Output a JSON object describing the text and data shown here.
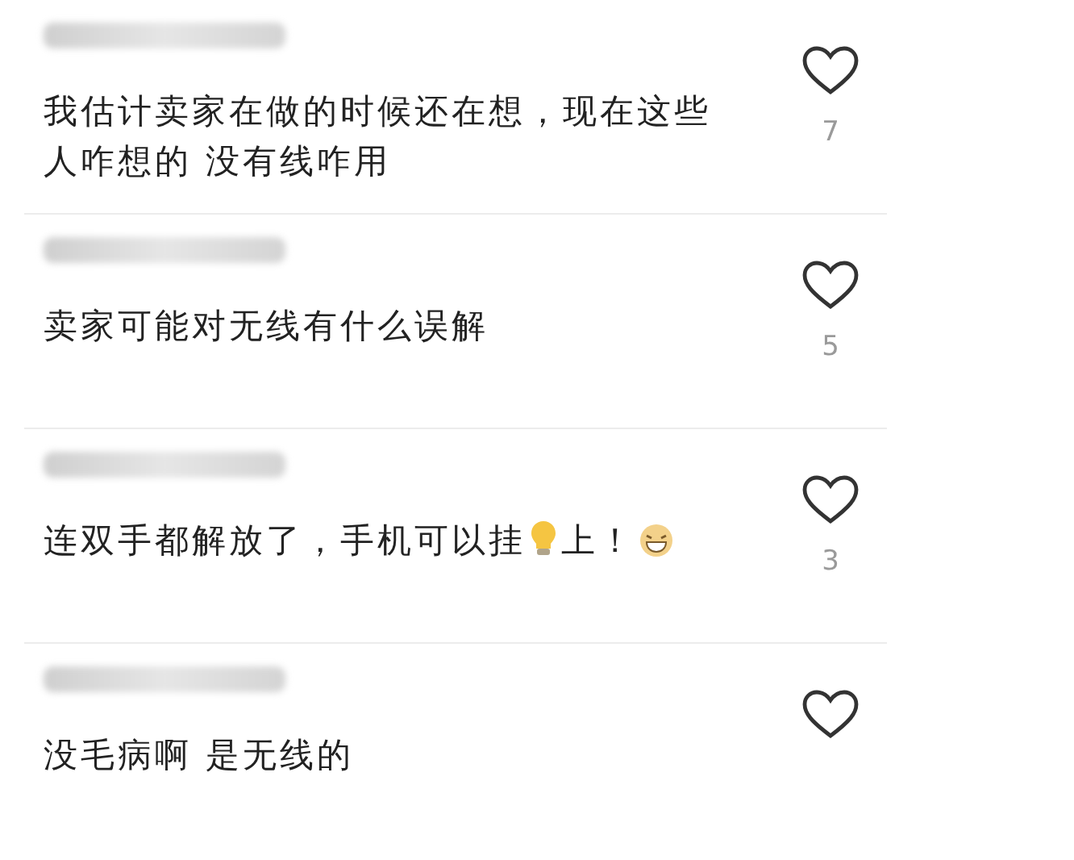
{
  "comments": [
    {
      "segments": [
        {
          "kind": "text",
          "text": "我估计卖家在做的时候还在想，现在这些人咋想的 没有线咋用"
        }
      ],
      "likes": "7"
    },
    {
      "segments": [
        {
          "kind": "text",
          "text": "卖家可能对无线有什么误解"
        }
      ],
      "likes": "5"
    },
    {
      "segments": [
        {
          "kind": "text",
          "text": "连双手都解放了，手机可以挂"
        },
        {
          "kind": "bulb"
        },
        {
          "kind": "text",
          "text": "上！"
        },
        {
          "kind": "grin"
        }
      ],
      "likes": "3"
    },
    {
      "segments": [
        {
          "kind": "text",
          "text": "没毛病啊 是无线的"
        }
      ]
    }
  ]
}
